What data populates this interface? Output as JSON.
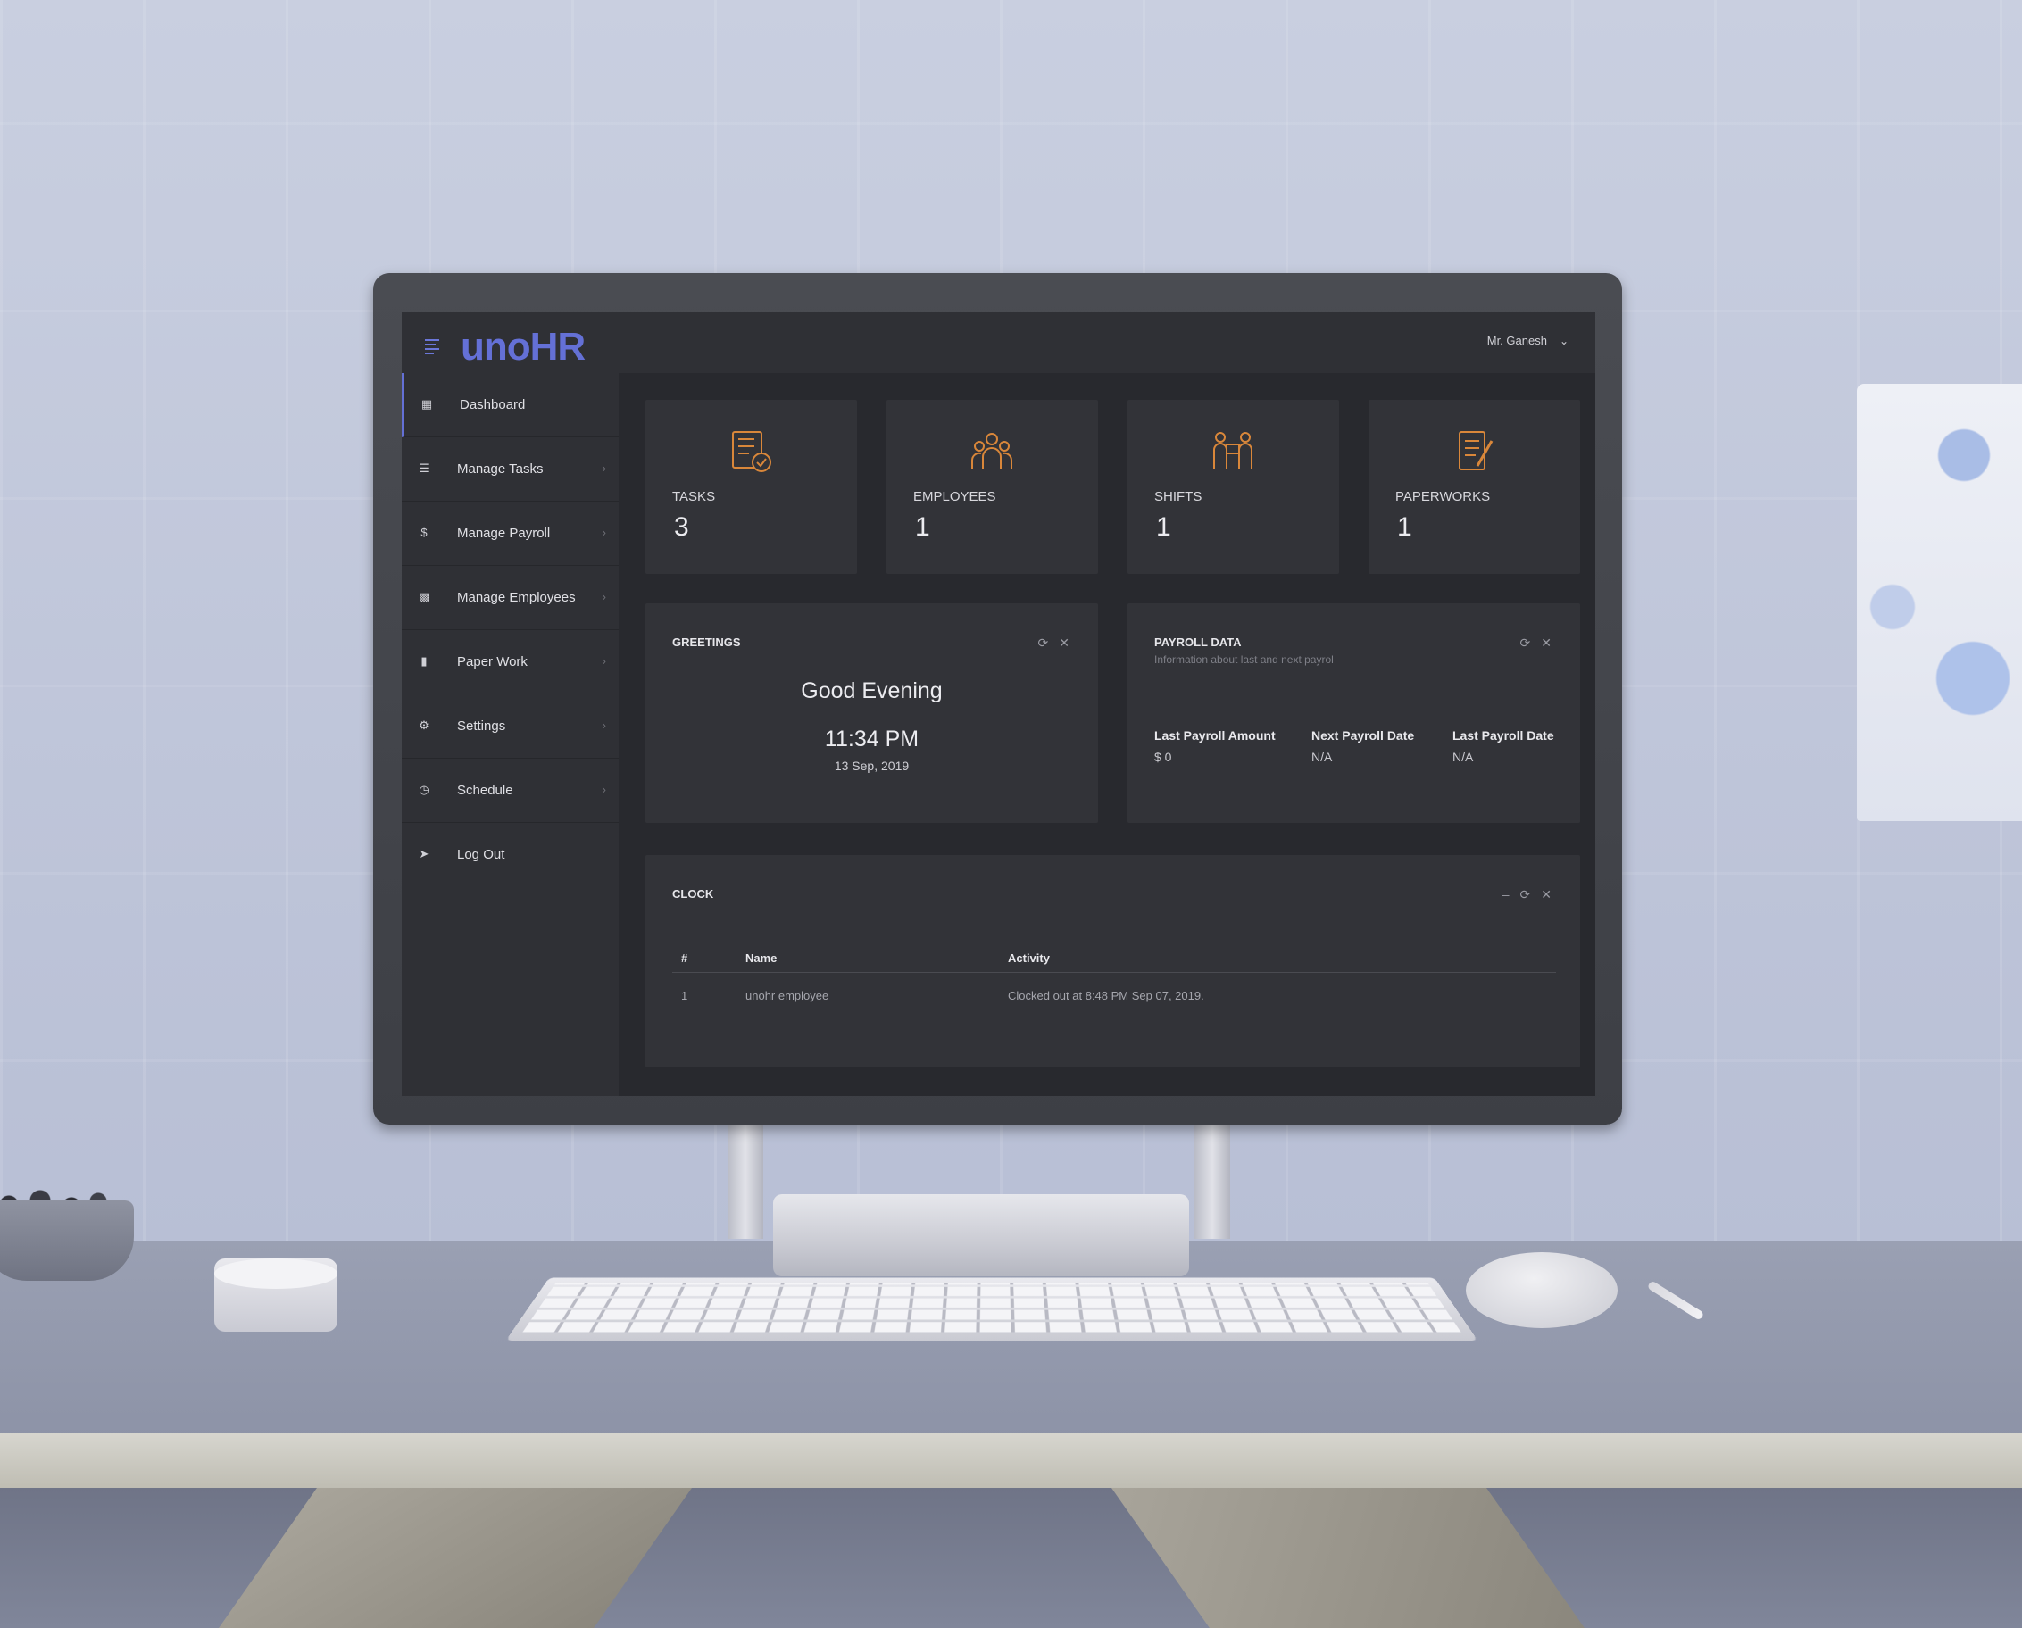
{
  "app": {
    "logo": "unoHR",
    "user": "Mr. Ganesh"
  },
  "sidebar": {
    "items": [
      {
        "label": "Dashboard",
        "icon": "dashboard-icon"
      },
      {
        "label": "Manage Tasks",
        "icon": "tasks-icon"
      },
      {
        "label": "Manage Payroll",
        "icon": "dollar-icon"
      },
      {
        "label": "Manage Employees",
        "icon": "id-card-icon"
      },
      {
        "label": "Paper Work",
        "icon": "document-icon"
      },
      {
        "label": "Settings",
        "icon": "gear-icon"
      },
      {
        "label": "Schedule",
        "icon": "clock-icon"
      },
      {
        "label": "Log Out",
        "icon": "logout-icon"
      }
    ]
  },
  "stats": [
    {
      "label": "TASKS",
      "value": "3",
      "icon": "checklist-icon"
    },
    {
      "label": "EMPLOYEES",
      "value": "1",
      "icon": "team-icon"
    },
    {
      "label": "SHIFTS",
      "value": "1",
      "icon": "shift-swap-icon"
    },
    {
      "label": "PAPERWORKS",
      "value": "1",
      "icon": "paperwork-icon"
    }
  ],
  "greetings": {
    "title": "GREETINGS",
    "message": "Good Evening",
    "time": "11:34 PM",
    "date": "13 Sep, 2019"
  },
  "payroll": {
    "title": "PAYROLL DATA",
    "subtitle": "Information about last and next payrol",
    "columns": [
      {
        "label": "Last Payroll Amount",
        "value": "$ 0"
      },
      {
        "label": "Next Payroll Date",
        "value": "N/A"
      },
      {
        "label": "Last Payroll Date",
        "value": "N/A"
      }
    ]
  },
  "clock": {
    "title": "CLOCK",
    "headers": [
      "#",
      "Name",
      "Activity"
    ],
    "rows": [
      {
        "num": "1",
        "name": "unohr employee",
        "activity": "Clocked out at 8:48 PM Sep 07, 2019."
      }
    ]
  },
  "panel_tools": {
    "minimize": "–",
    "refresh": "⟳",
    "close": "✕"
  },
  "colors": {
    "accent": "#6470d6",
    "icon_orange": "#d9873a",
    "screen_bg": "#28292e",
    "card_bg": "#323338"
  }
}
